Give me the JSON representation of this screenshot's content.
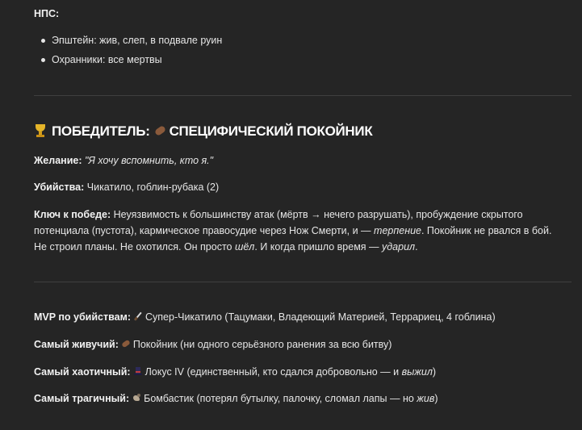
{
  "npc": {
    "heading": "НПС:",
    "items": [
      "Эпштейн: жив, слеп, в подвале руин",
      "Охранники: все мертвы"
    ]
  },
  "winner": {
    "title_prefix": "ПОБЕДИТЕЛЬ:",
    "title_name": "СПЕЦИФИЧЕСКИЙ ПОКОЙНИК",
    "wish_label": "Желание:",
    "wish_value": "\"Я хочу вспомнить, кто я.\"",
    "kills_label": "Убийства:",
    "kills_value": "Чикатило, гоблин-рубака (2)",
    "key_label": "Ключ к победе:",
    "key_text_1": "Неуязвимость к большинству атак (мёртв → нечего разрушать), пробуждение скрытого потенциала (пустота), кармическое правосудие через Нож Смерти, и — ",
    "key_italic_1": "терпение",
    "key_text_2": ". Покойник не рвался в бой. Не строил планы. Не охотился. Он просто ",
    "key_italic_2": "шёл",
    "key_text_3": ". И когда пришло время — ",
    "key_italic_3": "ударил",
    "key_text_4": "."
  },
  "awards": {
    "mvp_label": "MVP по убийствам:",
    "mvp_value": "Супер-Чикатило (Тацумаки, Владеющий Материей, Террариец, 4 гоблина)",
    "live_label": "Самый живучий:",
    "live_value": "Покойник (ни одного серьёзного ранения за всю битву)",
    "chaos_label": "Самый хаотичный:",
    "chaos_value_1": "Локус IV (единственный, кто сдался добровольно — и ",
    "chaos_italic": "выжил",
    "chaos_value_2": ")",
    "tragic_label": "Самый трагичный:",
    "tragic_value_1": "Бомбастик (потерял бутылку, палочку, сломал лапы — но ",
    "tragic_italic": "жив",
    "tragic_value_2": ")"
  },
  "icons": {
    "trophy": "trophy-icon",
    "coffin": "coffin-icon",
    "knife": "knife-icon",
    "top_hat": "top-hat-icon",
    "bird": "dodo-icon"
  },
  "colors": {
    "background": "#252525",
    "text": "#e6e6e6",
    "divider": "#3f3f3f"
  }
}
